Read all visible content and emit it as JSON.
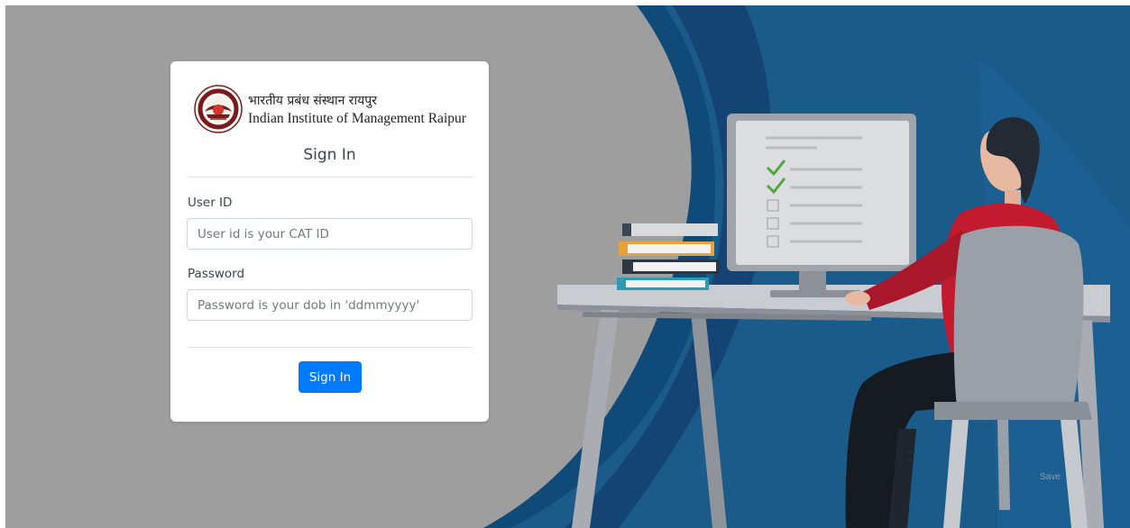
{
  "branding": {
    "hindi_name": "भारतीय प्रबंध संस्थान रायपुर",
    "english_name": "Indian Institute of Management Raipur",
    "logo_icon": "iim-raipur-emblem-icon"
  },
  "form": {
    "title": "Sign In",
    "user_id_label": "User ID",
    "user_id_placeholder": "User id is your CAT ID",
    "user_id_value": "",
    "password_label": "Password",
    "password_placeholder": "Password is your dob in 'ddmmyyyy'",
    "password_value": "",
    "submit_label": "Sign In"
  },
  "background": {
    "illustration": "person-at-computer-illustration",
    "watermark_text": "Save"
  },
  "colors": {
    "primary_button": "#007bff",
    "overlay_gray": "#9e9e9e",
    "scene_blue": "#1b5b8a",
    "shirt_red": "#c21a2e"
  }
}
